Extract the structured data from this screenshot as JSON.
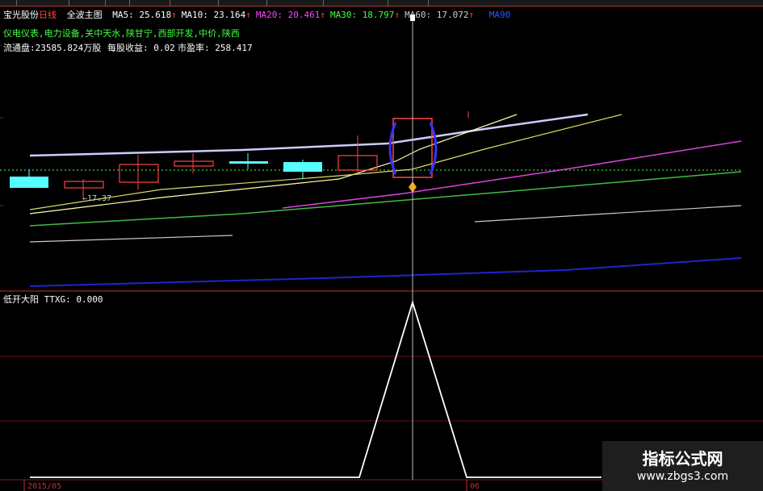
{
  "header": {
    "stock_name": "宝光股份",
    "period": "日线",
    "chart_mode": "全波主图",
    "ma": [
      {
        "label": "MA5: 25.618",
        "arrow": "↑",
        "color": "#ffffff"
      },
      {
        "label": "MA10: 23.164",
        "arrow": "↑",
        "color": "#ffffff"
      },
      {
        "label": "MA20: 20.461",
        "arrow": "↑",
        "color": "#ff44ff"
      },
      {
        "label": "MA30: 18.797",
        "arrow": "↑",
        "color": "#44ff44"
      },
      {
        "label": "MA60: 17.072",
        "arrow": "↑",
        "color": "#cccccc"
      }
    ],
    "ma_last": "MA90",
    "concepts": "仪电仪表,电力设备,关中天水,陕甘宁,西部开发,中价,陕西",
    "float_label": "流通盘:",
    "float_value": "23585.824万股",
    "eps_label": "每股收益:",
    "eps_value": "0.02",
    "pe_label": "市盈率:",
    "pe_value": "258.417"
  },
  "price_annotation": "←17.37",
  "indicator": {
    "name": "低开大阳",
    "value_label": "TTXG: 0.000"
  },
  "dates": {
    "left": "2015/05",
    "right": "06"
  },
  "watermark": {
    "line1": "指标公式网",
    "line2": "www.zbgs3.com"
  },
  "colors": {
    "background": "#000000",
    "frame": "#8b1a1a",
    "up_candle": "#ff4444",
    "down_candle": "#55ffff",
    "concept_text": "#44ff44",
    "period_text": "#ff4444"
  }
}
